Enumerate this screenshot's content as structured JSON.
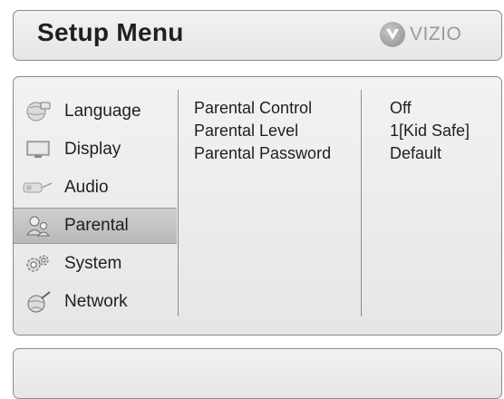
{
  "header": {
    "title": "Setup Menu",
    "logo_text": "VIZIO"
  },
  "menu": {
    "items": [
      {
        "label": "Language",
        "icon": "language-icon"
      },
      {
        "label": "Display",
        "icon": "display-icon"
      },
      {
        "label": "Audio",
        "icon": "audio-icon"
      },
      {
        "label": "Parental",
        "icon": "parental-icon",
        "selected": true
      },
      {
        "label": "System",
        "icon": "system-icon"
      },
      {
        "label": "Network",
        "icon": "network-icon"
      }
    ]
  },
  "settings": [
    {
      "name": "Parental Control",
      "value": "Off"
    },
    {
      "name": "Parental Level",
      "value": "1[Kid Safe]"
    },
    {
      "name": "Parental Password",
      "value": "Default"
    }
  ],
  "colors": {
    "panel": "#ececec",
    "border": "#8a8a8a",
    "selected": "#c4c4c4"
  }
}
